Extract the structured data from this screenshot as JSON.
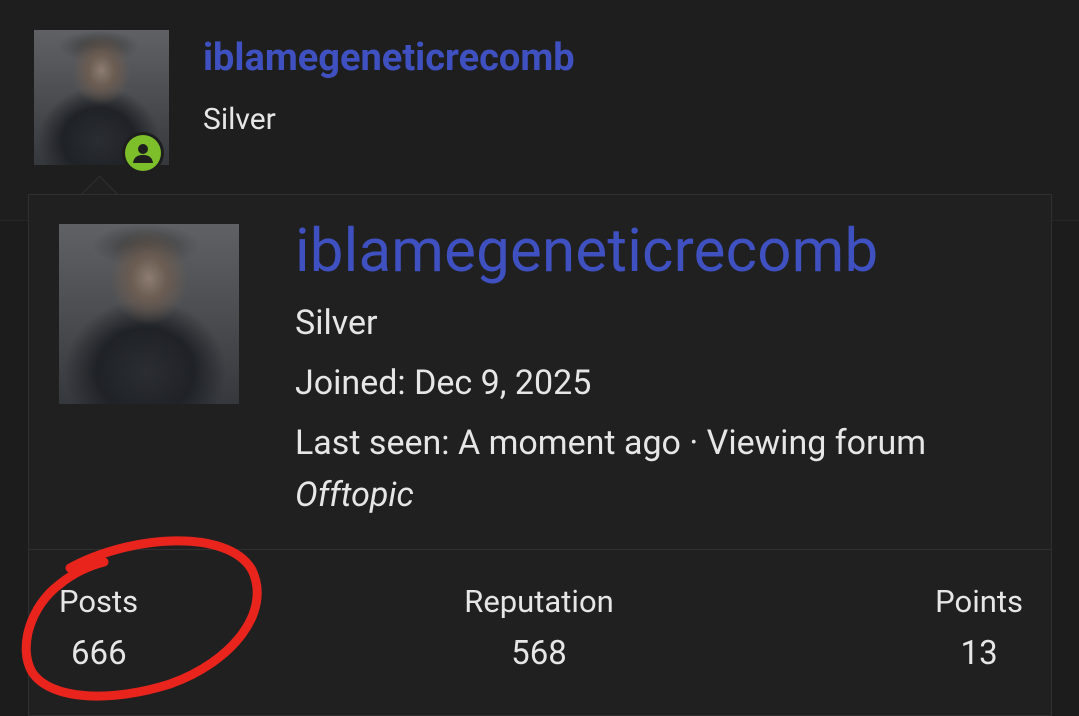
{
  "header": {
    "username": "iblamegeneticrecomb",
    "rank": "Silver",
    "online_color": "#7cbf2a"
  },
  "card": {
    "username": "iblamegeneticrecomb",
    "rank": "Silver",
    "joined": "Joined: Dec 9, 2025",
    "last_seen": "Last seen: A moment ago · Viewing forum",
    "forum": "Offtopic"
  },
  "stats": [
    {
      "label": "Posts",
      "value": "666"
    },
    {
      "label": "Reputation",
      "value": "568"
    },
    {
      "label": "Points",
      "value": "13"
    }
  ],
  "colors": {
    "username": "#3f51c0",
    "background": "#1c1c1c",
    "annotation": "#e8241c"
  }
}
